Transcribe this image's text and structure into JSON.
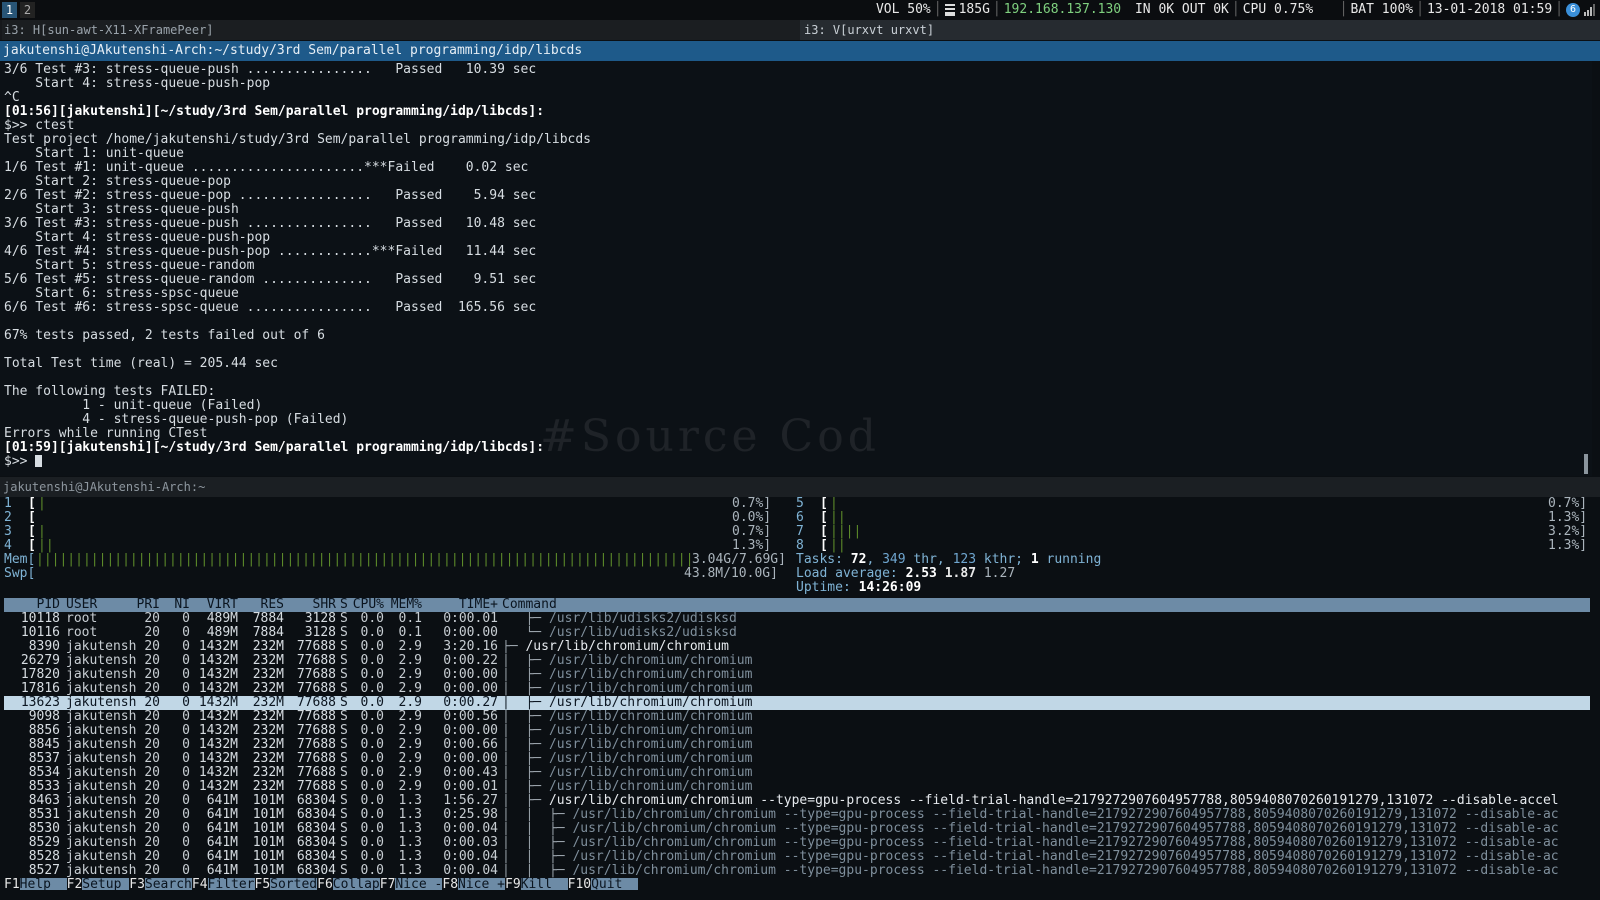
{
  "topbar": {
    "workspaces": [
      "1",
      "2"
    ],
    "vol": "VOL 50%",
    "disk": "185G",
    "ip": "192.168.137.130",
    "net": "IN 0K OUT 0K",
    "cpu": "CPU 0.75%",
    "bat": "BAT 100%",
    "datetime": "13-01-2018 01:59",
    "tray_badge": "6"
  },
  "i3": {
    "left_tab": "i3: H[sun-awt-X11-XFramePeer]",
    "right_tab": "i3: V[urxvt urxvt]"
  },
  "term1": {
    "title": "jakutenshi@JAkutenshi-Arch:~/study/3rd Sem/parallel programming/idp/libcds",
    "lines": [
      "3/6 Test #3: stress-queue-push ................   Passed   10.39 sec",
      "    Start 4: stress-queue-push-pop",
      "^C",
      "[01:56][jakutenshi][~/study/3rd Sem/parallel programming/idp/libcds]:",
      "$>> ctest",
      "Test project /home/jakutenshi/study/3rd Sem/parallel programming/idp/libcds",
      "    Start 1: unit-queue",
      "1/6 Test #1: unit-queue ......................***Failed    0.02 sec",
      "    Start 2: stress-queue-pop",
      "2/6 Test #2: stress-queue-pop .................   Passed    5.94 sec",
      "    Start 3: stress-queue-push",
      "3/6 Test #3: stress-queue-push ................   Passed   10.48 sec",
      "    Start 4: stress-queue-push-pop",
      "4/6 Test #4: stress-queue-push-pop ............***Failed   11.44 sec",
      "    Start 5: stress-queue-random",
      "5/6 Test #5: stress-queue-random ..............   Passed    9.51 sec",
      "    Start 6: stress-spsc-queue",
      "6/6 Test #6: stress-spsc-queue ................   Passed  165.56 sec",
      "",
      "67% tests passed, 2 tests failed out of 6",
      "",
      "Total Test time (real) = 205.44 sec",
      "",
      "The following tests FAILED:",
      "          1 - unit-queue (Failed)",
      "          4 - stress-queue-push-pop (Failed)",
      "Errors while running CTest",
      "[01:59][jakutenshi][~/study/3rd Sem/parallel programming/idp/libcds]:",
      "$>> "
    ],
    "watermark": "#Source Cod"
  },
  "term2": {
    "title": "jakutenshi@JAkutenshi-Arch:~"
  },
  "htop": {
    "cpus_left": [
      {
        "num": "1",
        "bars": "|",
        "pct": "0.7%]"
      },
      {
        "num": "2",
        "bars": "",
        "pct": "0.0%]"
      },
      {
        "num": "3",
        "bars": "|",
        "pct": "0.7%]"
      },
      {
        "num": "4",
        "bars": "||",
        "pct": "1.3%]"
      }
    ],
    "cpus_right": [
      {
        "num": "5",
        "bars": "|",
        "pct": "0.7%]"
      },
      {
        "num": "6",
        "bars": "||",
        "pct": "1.3%]"
      },
      {
        "num": "7",
        "bars": "||||",
        "pct": "3.2%]"
      },
      {
        "num": "8",
        "bars": "||",
        "pct": "1.3%]"
      }
    ],
    "mem_label": "Mem[",
    "mem_bars": "||||||||||||||||||||||||||||||||||||||||||||||||||||||||||||||||||||||||||||||||||||||",
    "mem_value": "3.04G/7.69G]",
    "swp_label": "Swp[",
    "swp_value": "43.8M/10.0G]",
    "tasks": {
      "label": "Tasks: ",
      "tasks": "72",
      "sep1": ", ",
      "thr": "349",
      "thr_l": " thr, ",
      "kthr": "123",
      "kthr_l": " kthr; ",
      "running": "1",
      "running_l": " running"
    },
    "load": {
      "label": "Load average: ",
      "a": "2.53",
      "b": "1.87",
      "c": "1.27"
    },
    "uptime": {
      "label": "Uptime: ",
      "value": "14:26:09"
    },
    "columns": [
      "PID",
      "USER",
      "PRI",
      "NI",
      "VIRT",
      "RES",
      "SHR",
      "S",
      "CPU%",
      "MEM%",
      "TIME+",
      "Command"
    ],
    "processes": [
      {
        "pid": "10118",
        "user": "root",
        "pri": "20",
        "ni": "0",
        "virt": "489M",
        "res": "7884",
        "shr": "3128",
        "s": "S",
        "cpu": "0.0",
        "mem": "0.1",
        "time": "0:00.01",
        "tree": "   ├─ ",
        "cmd": "/usr/lib/udisks2/udisksd",
        "dim": true,
        "sel": false
      },
      {
        "pid": "10116",
        "user": "root",
        "pri": "20",
        "ni": "0",
        "virt": "489M",
        "res": "7884",
        "shr": "3128",
        "s": "S",
        "cpu": "0.0",
        "mem": "0.1",
        "time": "0:00.00",
        "tree": "   └─ ",
        "cmd": "/usr/lib/udisks2/udisksd",
        "dim": true,
        "sel": false
      },
      {
        "pid": "8390",
        "user": "jakutensh",
        "pri": "20",
        "ni": "0",
        "virt": "1432M",
        "res": "232M",
        "shr": "77688",
        "s": "S",
        "cpu": "0.0",
        "mem": "2.9",
        "time": "3:20.16",
        "tree": "├─ ",
        "cmd": "/usr/lib/chromium/chromium",
        "dim": false,
        "sel": false
      },
      {
        "pid": "26279",
        "user": "jakutensh",
        "pri": "20",
        "ni": "0",
        "virt": "1432M",
        "res": "232M",
        "shr": "77688",
        "s": "S",
        "cpu": "0.0",
        "mem": "2.9",
        "time": "0:00.22",
        "tree": "│  ├─ ",
        "cmd": "/usr/lib/chromium/chromium",
        "dim": true,
        "sel": false
      },
      {
        "pid": "17820",
        "user": "jakutensh",
        "pri": "20",
        "ni": "0",
        "virt": "1432M",
        "res": "232M",
        "shr": "77688",
        "s": "S",
        "cpu": "0.0",
        "mem": "2.9",
        "time": "0:00.00",
        "tree": "│  ├─ ",
        "cmd": "/usr/lib/chromium/chromium",
        "dim": true,
        "sel": false
      },
      {
        "pid": "17816",
        "user": "jakutensh",
        "pri": "20",
        "ni": "0",
        "virt": "1432M",
        "res": "232M",
        "shr": "77688",
        "s": "S",
        "cpu": "0.0",
        "mem": "2.9",
        "time": "0:00.00",
        "tree": "│  ├─ ",
        "cmd": "/usr/lib/chromium/chromium",
        "dim": true,
        "sel": false
      },
      {
        "pid": "13623",
        "user": "jakutensh",
        "pri": "20",
        "ni": "0",
        "virt": "1432M",
        "res": "232M",
        "shr": "77688",
        "s": "S",
        "cpu": "0.0",
        "mem": "2.9",
        "time": "0:00.27",
        "tree": "│  ├─ ",
        "cmd": "/usr/lib/chromium/chromium",
        "dim": false,
        "sel": true
      },
      {
        "pid": "9098",
        "user": "jakutensh",
        "pri": "20",
        "ni": "0",
        "virt": "1432M",
        "res": "232M",
        "shr": "77688",
        "s": "S",
        "cpu": "0.0",
        "mem": "2.9",
        "time": "0:00.56",
        "tree": "│  ├─ ",
        "cmd": "/usr/lib/chromium/chromium",
        "dim": true,
        "sel": false
      },
      {
        "pid": "8856",
        "user": "jakutensh",
        "pri": "20",
        "ni": "0",
        "virt": "1432M",
        "res": "232M",
        "shr": "77688",
        "s": "S",
        "cpu": "0.0",
        "mem": "2.9",
        "time": "0:00.00",
        "tree": "│  ├─ ",
        "cmd": "/usr/lib/chromium/chromium",
        "dim": true,
        "sel": false
      },
      {
        "pid": "8845",
        "user": "jakutensh",
        "pri": "20",
        "ni": "0",
        "virt": "1432M",
        "res": "232M",
        "shr": "77688",
        "s": "S",
        "cpu": "0.0",
        "mem": "2.9",
        "time": "0:00.66",
        "tree": "│  ├─ ",
        "cmd": "/usr/lib/chromium/chromium",
        "dim": true,
        "sel": false
      },
      {
        "pid": "8537",
        "user": "jakutensh",
        "pri": "20",
        "ni": "0",
        "virt": "1432M",
        "res": "232M",
        "shr": "77688",
        "s": "S",
        "cpu": "0.0",
        "mem": "2.9",
        "time": "0:00.00",
        "tree": "│  ├─ ",
        "cmd": "/usr/lib/chromium/chromium",
        "dim": true,
        "sel": false
      },
      {
        "pid": "8534",
        "user": "jakutensh",
        "pri": "20",
        "ni": "0",
        "virt": "1432M",
        "res": "232M",
        "shr": "77688",
        "s": "S",
        "cpu": "0.0",
        "mem": "2.9",
        "time": "0:00.43",
        "tree": "│  ├─ ",
        "cmd": "/usr/lib/chromium/chromium",
        "dim": true,
        "sel": false
      },
      {
        "pid": "8533",
        "user": "jakutensh",
        "pri": "20",
        "ni": "0",
        "virt": "1432M",
        "res": "232M",
        "shr": "77688",
        "s": "S",
        "cpu": "0.0",
        "mem": "2.9",
        "time": "0:00.01",
        "tree": "│  ├─ ",
        "cmd": "/usr/lib/chromium/chromium",
        "dim": true,
        "sel": false
      },
      {
        "pid": "8463",
        "user": "jakutensh",
        "pri": "20",
        "ni": "0",
        "virt": "641M",
        "res": "101M",
        "shr": "68304",
        "s": "S",
        "cpu": "0.0",
        "mem": "1.3",
        "time": "1:56.27",
        "tree": "│  ├─ ",
        "cmd": "/usr/lib/chromium/chromium --type=gpu-process --field-trial-handle=2179272907604957788,8059408070260191279,131072 --disable-accel",
        "dim": false,
        "sel": false
      },
      {
        "pid": "8531",
        "user": "jakutensh",
        "pri": "20",
        "ni": "0",
        "virt": "641M",
        "res": "101M",
        "shr": "68304",
        "s": "S",
        "cpu": "0.0",
        "mem": "1.3",
        "time": "0:25.98",
        "tree": "│  │  ├─ ",
        "cmd": "/usr/lib/chromium/chromium --type=gpu-process --field-trial-handle=2179272907604957788,8059408070260191279,131072 --disable-ac",
        "dim": true,
        "sel": false
      },
      {
        "pid": "8530",
        "user": "jakutensh",
        "pri": "20",
        "ni": "0",
        "virt": "641M",
        "res": "101M",
        "shr": "68304",
        "s": "S",
        "cpu": "0.0",
        "mem": "1.3",
        "time": "0:00.04",
        "tree": "│  │  ├─ ",
        "cmd": "/usr/lib/chromium/chromium --type=gpu-process --field-trial-handle=2179272907604957788,8059408070260191279,131072 --disable-ac",
        "dim": true,
        "sel": false
      },
      {
        "pid": "8529",
        "user": "jakutensh",
        "pri": "20",
        "ni": "0",
        "virt": "641M",
        "res": "101M",
        "shr": "68304",
        "s": "S",
        "cpu": "0.0",
        "mem": "1.3",
        "time": "0:00.03",
        "tree": "│  │  ├─ ",
        "cmd": "/usr/lib/chromium/chromium --type=gpu-process --field-trial-handle=2179272907604957788,8059408070260191279,131072 --disable-ac",
        "dim": true,
        "sel": false
      },
      {
        "pid": "8528",
        "user": "jakutensh",
        "pri": "20",
        "ni": "0",
        "virt": "641M",
        "res": "101M",
        "shr": "68304",
        "s": "S",
        "cpu": "0.0",
        "mem": "1.3",
        "time": "0:00.04",
        "tree": "│  │  ├─ ",
        "cmd": "/usr/lib/chromium/chromium --type=gpu-process --field-trial-handle=2179272907604957788,8059408070260191279,131072 --disable-ac",
        "dim": true,
        "sel": false
      },
      {
        "pid": "8527",
        "user": "jakutensh",
        "pri": "20",
        "ni": "0",
        "virt": "641M",
        "res": "101M",
        "shr": "68304",
        "s": "S",
        "cpu": "0.0",
        "mem": "1.3",
        "time": "0:00.04",
        "tree": "│  │  ├─ ",
        "cmd": "/usr/lib/chromium/chromium --type=gpu-process --field-trial-handle=2179272907604957788,8059408070260191279,131072 --disable-ac",
        "dim": true,
        "sel": false
      }
    ],
    "fkeys": [
      {
        "key": "F1",
        "label": "Help  "
      },
      {
        "key": "F2",
        "label": "Setup "
      },
      {
        "key": "F3",
        "label": "Search"
      },
      {
        "key": "F4",
        "label": "Filter"
      },
      {
        "key": "F5",
        "label": "Sorted"
      },
      {
        "key": "F6",
        "label": "Collap"
      },
      {
        "key": "F7",
        "label": "Nice -"
      },
      {
        "key": "F8",
        "label": "Nice +"
      },
      {
        "key": "F9",
        "label": "Kill  "
      },
      {
        "key": "F10",
        "label": "Quit  "
      }
    ]
  },
  "colors": {
    "accent_blue": "#1e5a8a",
    "ip_green": "#7fd07f",
    "htop_header": "#6d8ba6",
    "selected_row": "#c1d7e6",
    "tree_dim": "#7f8f9c",
    "tray_icon": "#3a8fd9"
  }
}
